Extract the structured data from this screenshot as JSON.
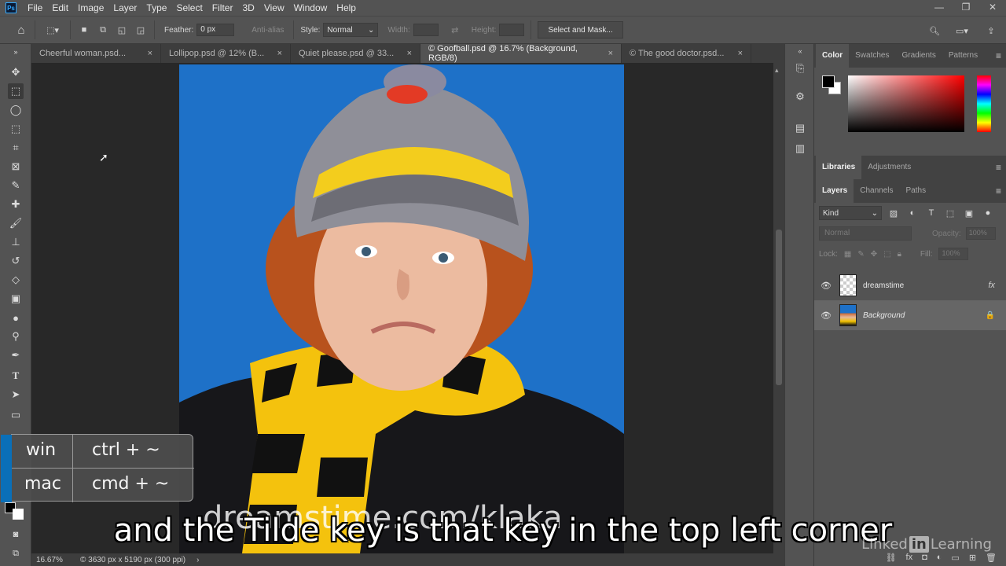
{
  "app": {
    "logo": "Ps"
  },
  "menu": [
    "File",
    "Edit",
    "Image",
    "Layer",
    "Type",
    "Select",
    "Filter",
    "3D",
    "View",
    "Window",
    "Help"
  ],
  "options": {
    "feather_label": "Feather:",
    "feather_value": "0 px",
    "antialias_label": "Anti-alias",
    "style_label": "Style:",
    "style_value": "Normal",
    "width_label": "Width:",
    "height_label": "Height:",
    "select_mask": "Select and Mask..."
  },
  "tabs": [
    {
      "label": "Cheerful woman.psd...",
      "close": "×"
    },
    {
      "label": "Lollipop.psd @ 12% (B...",
      "close": "×"
    },
    {
      "label": "Quiet please.psd @ 33...",
      "close": "×"
    },
    {
      "label": "© Goofball.psd @ 16.7% (Background, RGB/8)",
      "close": "×"
    },
    {
      "label": "© The good doctor.psd...",
      "close": "×"
    }
  ],
  "status": {
    "zoom": "16.67%",
    "info": "© 3630 px x 5190 px (300 ppi)"
  },
  "color_panel": {
    "tabs": [
      "Color",
      "Swatches",
      "Gradients",
      "Patterns"
    ]
  },
  "libraries_panel": {
    "tabs": [
      "Libraries",
      "Adjustments"
    ]
  },
  "layers_panel": {
    "tabs": [
      "Layers",
      "Channels",
      "Paths"
    ],
    "kind": "Kind",
    "blend_mode": "Normal",
    "opacity_label": "Opacity:",
    "opacity_value": "100%",
    "lock_label": "Lock:",
    "fill_label": "Fill:",
    "fill_value": "100%",
    "layers": [
      {
        "name": "dreamstime",
        "extra": "fx"
      },
      {
        "name": "Background",
        "extra": "🔒"
      }
    ]
  },
  "shortcut": {
    "win_label": "win",
    "win_keys": "ctrl + ~",
    "mac_label": "mac",
    "mac_keys": "cmd + ~"
  },
  "caption": "and the Tilde key is that key in the top left corner",
  "photo_watermark": "dreamstime.com/klaka",
  "brand": {
    "before": "Linked",
    "in": "in",
    "after": "Learning"
  },
  "colors": {
    "accent": "#31a8ff",
    "photo_bg": "#1e71c8"
  }
}
